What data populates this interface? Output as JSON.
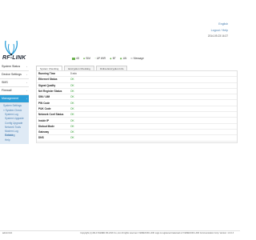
{
  "header": {
    "language": "English",
    "user": "Logout / Help",
    "datetime": "2014-09-23 16:27"
  },
  "logo": {
    "text": "RF-LINK"
  },
  "statusbar": [
    {
      "icon": "signal-icon",
      "label": "4G"
    },
    {
      "icon": "sim-icon",
      "label": "SIM"
    },
    {
      "icon": "wifi-icon",
      "label": "AP WiFi"
    },
    {
      "icon": "bt-icon",
      "label": "BT"
    },
    {
      "icon": "ethernet-icon",
      "label": "AN"
    },
    {
      "icon": "message-icon",
      "label": "Message"
    }
  ],
  "sidebar": {
    "items": [
      {
        "label": "System Status",
        "arrow": "›"
      },
      {
        "label": "Device Settings",
        "arrow": "›"
      },
      {
        "label": "SMS",
        "arrow": "›"
      },
      {
        "label": "Firewall",
        "arrow": "›"
      },
      {
        "label": "Management",
        "arrow": "›"
      }
    ],
    "sub": [
      {
        "label": "System Settings"
      },
      {
        "label": "» System Check"
      }
    ],
    "subsub": [
      {
        "label": "System Log"
      },
      {
        "label": "System Upgrade"
      },
      {
        "label": "Config Upgrade"
      },
      {
        "label": "Network Tools"
      },
      {
        "label": "Modem Log Catching"
      },
      {
        "label": "Reboot"
      },
      {
        "label": "Help"
      }
    ]
  },
  "tabs": [
    {
      "label": "System Checking"
    },
    {
      "label": "Encryption Checking"
    },
    {
      "label": "Online Encryption Info"
    }
  ],
  "table": [
    {
      "key": "Running Time",
      "value": "0 min"
    },
    {
      "key": "Ethernet Status",
      "value": "OK"
    },
    {
      "key": "Signal Quality",
      "value": "OK"
    },
    {
      "key": "Net Register Status",
      "value": "OK"
    },
    {
      "key": "SIM / UIM",
      "value": "OK"
    },
    {
      "key": "PIN Code",
      "value": "OK"
    },
    {
      "key": "PUK Code",
      "value": "OK"
    },
    {
      "key": "Network Conf Status",
      "value": "OK"
    },
    {
      "key": "Inside IP",
      "value": "OK"
    },
    {
      "key": "Dialout Mode",
      "value": "OK"
    },
    {
      "key": "Gateway",
      "value": "OK"
    },
    {
      "key": "DNS",
      "value": "OK"
    }
  ],
  "footer": {
    "left": "admin.html",
    "right": "Copyright (c) 2014 XIAMEN RF-LINK Co.,Ltd. All rights reserved. XIAMEN RF-LINK Logo is registered trademark of XIAMEN RF-LINK Communication Corp. Version: 1.0.0.3"
  }
}
